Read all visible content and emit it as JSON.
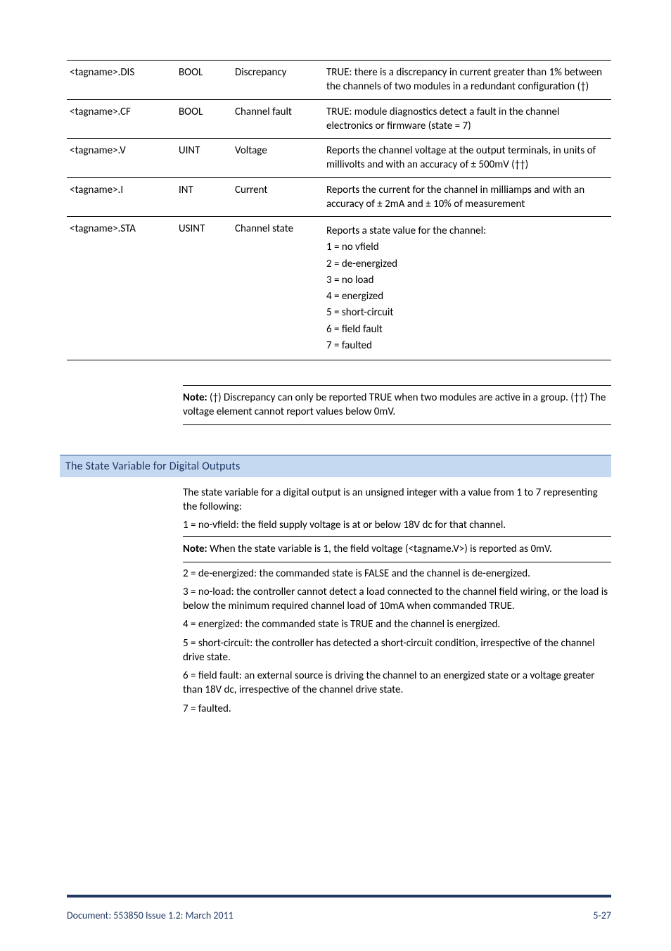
{
  "table": {
    "r1": {
      "tag": "<tagname>.DIS",
      "type": "BOOL",
      "name": "Discrepancy",
      "desc": "TRUE: there is a discrepancy in current greater than 1% between the channels of two modules in a redundant configuration (†)"
    },
    "r2": {
      "tag": "<tagname>.CF",
      "type": "BOOL",
      "name": "Channel fault",
      "desc": "TRUE: module diagnostics detect a fault in the channel electronics or firmware (state = 7)"
    },
    "r3": {
      "tag": "<tagname>.V",
      "type": "UINT",
      "name": "Voltage",
      "desc": "Reports the channel voltage at the output terminals, in units of millivolts and with an accuracy of ± 500mV (††)"
    },
    "r4": {
      "tag": "<tagname>.I",
      "type": "INT",
      "name": "Current",
      "desc": "Reports the current for the channel in milliamps and with an accuracy of ± 2mA and ± 10% of measurement"
    },
    "r5": {
      "tag": "<tagname>.STA",
      "type": "USINT",
      "name": "Channel state",
      "lead": "Reports a state value for the channel:",
      "s1": "1 = no vfield",
      "s2": "2 = de-energized",
      "s3": "3 = no load",
      "s4": "4 = energized",
      "s5": "5 = short-circuit",
      "s6": "6 = field fault",
      "s7": "7 = faulted"
    }
  },
  "note1_label": "Note:",
  "note1_text": " (†) Discrepancy can only be reported TRUE when two modules are active in a group. (††) The voltage element cannot report values below 0mV.",
  "section_title": "The State Variable for Digital Outputs",
  "p1": "The state variable for a digital output is an unsigned integer with a value from 1 to 7 representing the following:",
  "p2": "1 = no-vfield: the field supply voltage is at or below 18V dc for that channel.",
  "note2_label": "Note:",
  "note2_text": " When the state variable is 1, the field voltage (<tagname.V>) is reported as 0mV.",
  "p3": "2 = de-energized: the commanded state is FALSE and the channel is de-energized.",
  "p4": "3 = no-load: the controller cannot detect a load connected to the channel field wiring, or the load is below the minimum required channel load of 10mA when commanded TRUE.",
  "p5": "4 = energized: the commanded state is TRUE and the channel is energized.",
  "p6": "5 = short-circuit: the controller has detected a short-circuit condition, irrespective of the channel drive state.",
  "p7": "6 = field fault: an external source is driving the channel to an energized state or a voltage greater than 18V dc, irrespective of the channel drive state.",
  "p8": "7 = faulted.",
  "footer_left": "Document: 553850 Issue 1.2: March 2011",
  "footer_right": "5-27"
}
